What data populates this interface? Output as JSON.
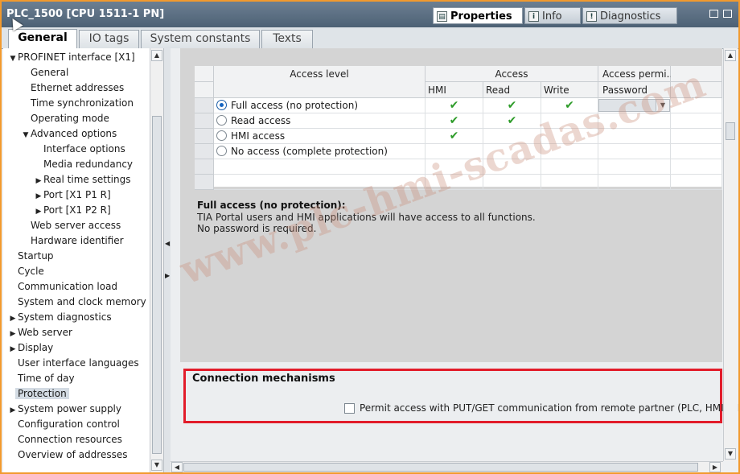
{
  "window": {
    "title": "PLC_1500 [CPU 1511-1 PN]"
  },
  "right_tabs": [
    {
      "label": "Properties",
      "icon": "properties-icon",
      "active": true
    },
    {
      "label": "Info",
      "icon": "info-icon",
      "active": false
    },
    {
      "label": "Diagnostics",
      "icon": "diagnostics-icon",
      "active": false
    }
  ],
  "sub_tabs": [
    "General",
    "IO tags",
    "System constants",
    "Texts"
  ],
  "tree": [
    {
      "label": "PROFINET interface [X1]",
      "level": 0,
      "arrow": "▼"
    },
    {
      "label": "General",
      "level": 1,
      "arrow": ""
    },
    {
      "label": "Ethernet addresses",
      "level": 1,
      "arrow": ""
    },
    {
      "label": "Time synchronization",
      "level": 1,
      "arrow": ""
    },
    {
      "label": "Operating mode",
      "level": 1,
      "arrow": ""
    },
    {
      "label": "Advanced options",
      "level": 1,
      "arrow": "▼"
    },
    {
      "label": "Interface options",
      "level": 2,
      "arrow": ""
    },
    {
      "label": "Media redundancy",
      "level": 2,
      "arrow": ""
    },
    {
      "label": "Real time settings",
      "level": 2,
      "arrow": "▶"
    },
    {
      "label": "Port [X1 P1 R]",
      "level": 2,
      "arrow": "▶"
    },
    {
      "label": "Port [X1 P2 R]",
      "level": 2,
      "arrow": "▶"
    },
    {
      "label": "Web server access",
      "level": 1,
      "arrow": ""
    },
    {
      "label": "Hardware identifier",
      "level": 1,
      "arrow": ""
    },
    {
      "label": "Startup",
      "level": 0,
      "arrow": ""
    },
    {
      "label": "Cycle",
      "level": 0,
      "arrow": ""
    },
    {
      "label": "Communication load",
      "level": 0,
      "arrow": ""
    },
    {
      "label": "System and clock memory",
      "level": 0,
      "arrow": ""
    },
    {
      "label": "System diagnostics",
      "level": 0,
      "arrow": "▶"
    },
    {
      "label": "Web server",
      "level": 0,
      "arrow": "▶"
    },
    {
      "label": "Display",
      "level": 0,
      "arrow": "▶"
    },
    {
      "label": "User interface languages",
      "level": 0,
      "arrow": ""
    },
    {
      "label": "Time of day",
      "level": 0,
      "arrow": ""
    },
    {
      "label": "Protection",
      "level": 0,
      "arrow": "",
      "selected": true
    },
    {
      "label": "System power supply",
      "level": 0,
      "arrow": "▶"
    },
    {
      "label": "Configuration control",
      "level": 0,
      "arrow": ""
    },
    {
      "label": "Connection resources",
      "level": 0,
      "arrow": ""
    },
    {
      "label": "Overview of addresses",
      "level": 0,
      "arrow": ""
    }
  ],
  "access_table": {
    "headers": {
      "access_level": "Access level",
      "access": "Access",
      "access_permission": "Access permi...",
      "hmi": "HMI",
      "read": "Read",
      "write": "Write",
      "password": "Password"
    },
    "rows": [
      {
        "label": "Full access (no protection)",
        "selected": true,
        "hmi": true,
        "read": true,
        "write": true
      },
      {
        "label": "Read access",
        "selected": false,
        "hmi": true,
        "read": true,
        "write": false
      },
      {
        "label": "HMI access",
        "selected": false,
        "hmi": true,
        "read": false,
        "write": false
      },
      {
        "label": "No access (complete protection)",
        "selected": false,
        "hmi": false,
        "read": false,
        "write": false
      }
    ],
    "check_glyph": "✔"
  },
  "description": {
    "title": "Full access (no protection):",
    "line1": "TIA Portal users and HMI applications will have access to all functions.",
    "line2": "No password is required."
  },
  "connection": {
    "title": "Connection mechanisms",
    "checkbox_label": "Permit access with PUT/GET communication from remote partner (PLC, HMI, OPC, ...)",
    "checked": false
  },
  "watermark": "www.plc-hmi-scadas.com",
  "colors": {
    "accent_border": "#f29a2e",
    "highlight_box": "#e21c2a",
    "check": "#2e9c2a"
  }
}
